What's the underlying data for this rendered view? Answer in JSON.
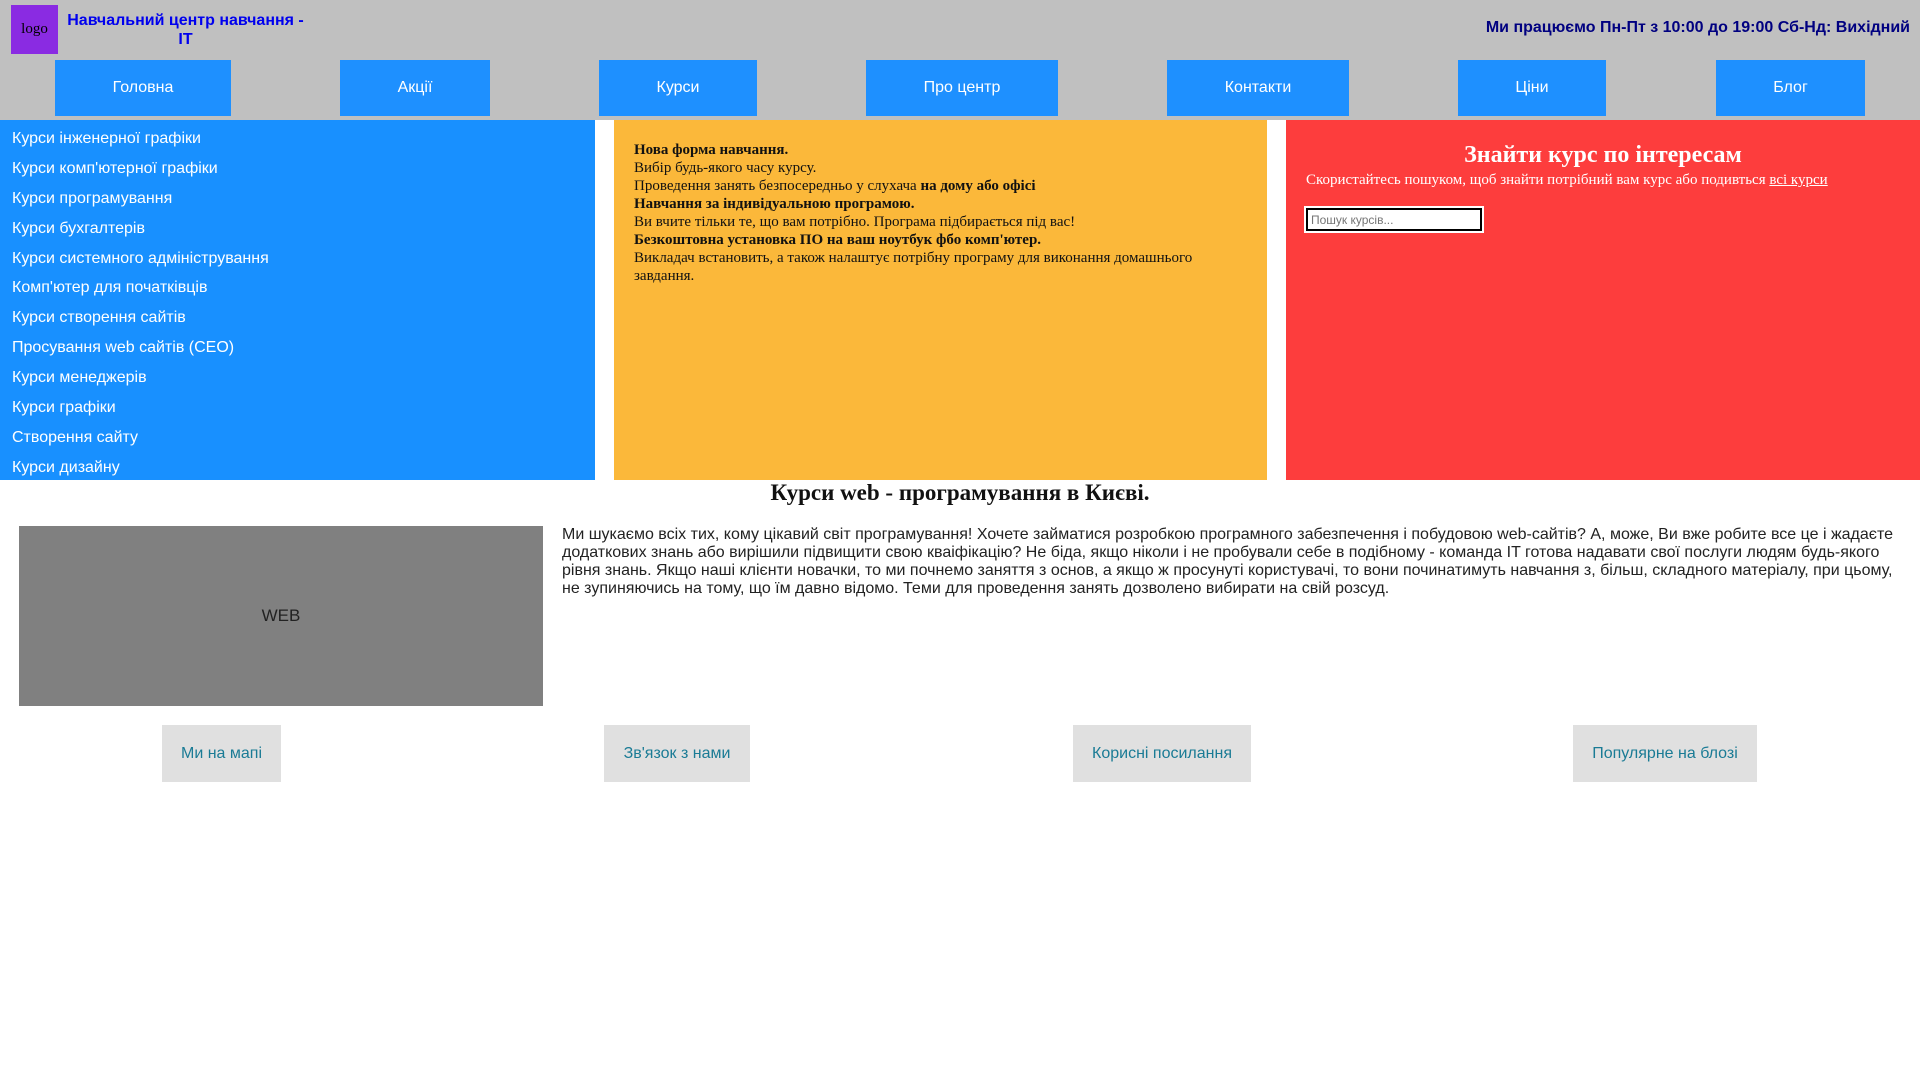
{
  "header": {
    "logo_text": "logo",
    "title": "Навчальний центр навчання - IT",
    "hours": "Ми працюємо Пн-Пт з 10:00 до 19:00 Сб-Нд: Вихідний"
  },
  "nav": {
    "items": [
      "Головна",
      "Акції",
      "Курси",
      "Про центр",
      "Контакти",
      "Ціни",
      "Блог"
    ]
  },
  "sidebar": {
    "items": [
      "Курси інженерної графіки",
      "Курси комп'ютерної графіки",
      "Курси програмування",
      "Курси бухгалтерів",
      "Курси системного адміністрування",
      "Комп'ютер для початківців",
      "Курси створення сайтів",
      "Просування web сайтів (CEO)",
      "Курси менеджерів",
      "Курси графіки",
      "Створення сайту",
      "Курси дизайну"
    ]
  },
  "promo": {
    "line1": "Нова форма навчання.",
    "line2": "Вибір будь-якого часу курсу.",
    "line3_text": "Проведення занять безпосередньо у слухача ",
    "line3_bold": "на дому або офісі",
    "line4": "Навчання за індивідуальною програмою.",
    "line5": "Ви вчите тільки те, що вам потрібно. Програма підбирається під вас!",
    "line6": "Безкоштовна установка ПО на ваш ноутбук фбо комп'ютер.",
    "line7": "Викладач встановить, а також налаштує потрібну програму для виконання домашнього завдання."
  },
  "search": {
    "title": "Знайти курс по інтересам",
    "text": "Скористайтесь пошуком, щоб знайти потрібний вам курс або подивться ",
    "link": "всі курси",
    "placeholder": "Пошук курсів..."
  },
  "main": {
    "heading": "Курси web - програмування в Києві.",
    "image_label": "WEB",
    "intro": "Ми шукаємо всіх тих, кому цікавий світ програмування! Хочете займатися розробкою програмного забезпечення і побудовою web-сайтів? А, може, Ви вже робите все це і жадаєте додаткових знань або вирішили підвищити свою кваіфікацію? Не біда, якщо ніколи і не пробували себе в подібному - команда IT готова надавати свої послуги людям будь-якого рівня знань. Якщо наші клієнти новачки, то ми почнемо заняття з основ, а якщо ж просунуті користувачі, то вони починатимуть навчання з, більш, складного матеріалу, при цьому, не зупиняючись на тому, що їм давно відомо. Теми для проведення занять дозволено вибирати на свій розсуд."
  },
  "footer": {
    "links": [
      "Ми на мапі",
      "Зв'язок з нами",
      "Корисні посилання",
      "Популярне на блозі"
    ]
  },
  "colors": {
    "header_bg": "#c0c0c0",
    "accent_blue": "#1e90ff",
    "logo_purple": "#8a2be2",
    "promo_orange": "#fbb83a",
    "search_red": "#fd3d3d",
    "footer_link": "#1a7b95"
  }
}
